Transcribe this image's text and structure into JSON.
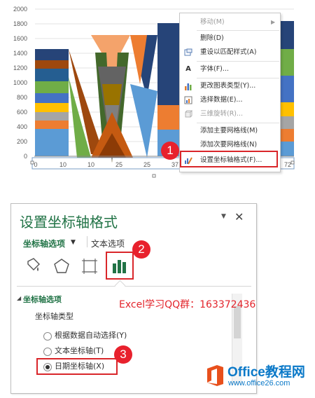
{
  "chart": {
    "y_ticks": [
      "2000",
      "1800",
      "1600",
      "1400",
      "1200",
      "1000",
      "800",
      "600",
      "400",
      "200",
      "0"
    ],
    "x_ticks": [
      "0",
      "10",
      "10",
      "25",
      "25",
      "37",
      "72"
    ]
  },
  "context_menu": {
    "items": [
      {
        "label": "移动(M)",
        "icon": "",
        "disabled": true,
        "submenu": true
      },
      {
        "label": "删除(D)",
        "icon": "",
        "disabled": false
      },
      {
        "label": "重设以匹配样式(A)",
        "icon": "reset-style-icon",
        "disabled": false
      },
      {
        "label": "字体(F)...",
        "icon": "font-icon",
        "disabled": false
      },
      {
        "label": "更改图表类型(Y)...",
        "icon": "change-chart-type-icon",
        "disabled": false
      },
      {
        "label": "选择数据(E)...",
        "icon": "select-data-icon",
        "disabled": false
      },
      {
        "label": "三维旋转(R)...",
        "icon": "3d-rotation-icon",
        "disabled": true
      },
      {
        "label": "添加主要网格线(M)",
        "icon": "",
        "disabled": false
      },
      {
        "label": "添加次要网格线(N)",
        "icon": "",
        "disabled": false
      },
      {
        "label": "设置坐标轴格式(F)...",
        "icon": "format-axis-icon",
        "disabled": false
      }
    ],
    "font_glyph": "A"
  },
  "badges": [
    "1",
    "2",
    "3"
  ],
  "pane": {
    "title": "设置坐标轴格式",
    "close": "✕",
    "dropdown": "▼",
    "tab_axis": "坐标轴选项",
    "tab_axis_arrow": "▼",
    "tab_text": "文本选项",
    "section_header": "坐标轴选项",
    "section_tri": "◢",
    "axis_type_label": "坐标轴类型",
    "radios": [
      {
        "label": "根据数据自动选择(Y)",
        "checked": false
      },
      {
        "label": "文本坐标轴(T)",
        "checked": false
      },
      {
        "label": "日期坐标轴(X)",
        "checked": true
      }
    ]
  },
  "annotation": "Excel学习QQ群：163372436",
  "watermark": {
    "title": "Office教程网",
    "url": "www.office26.com"
  },
  "colors": {
    "accent_green": "#217346",
    "highlight_red": "#d9262a",
    "badge_red": "#e8212d"
  }
}
